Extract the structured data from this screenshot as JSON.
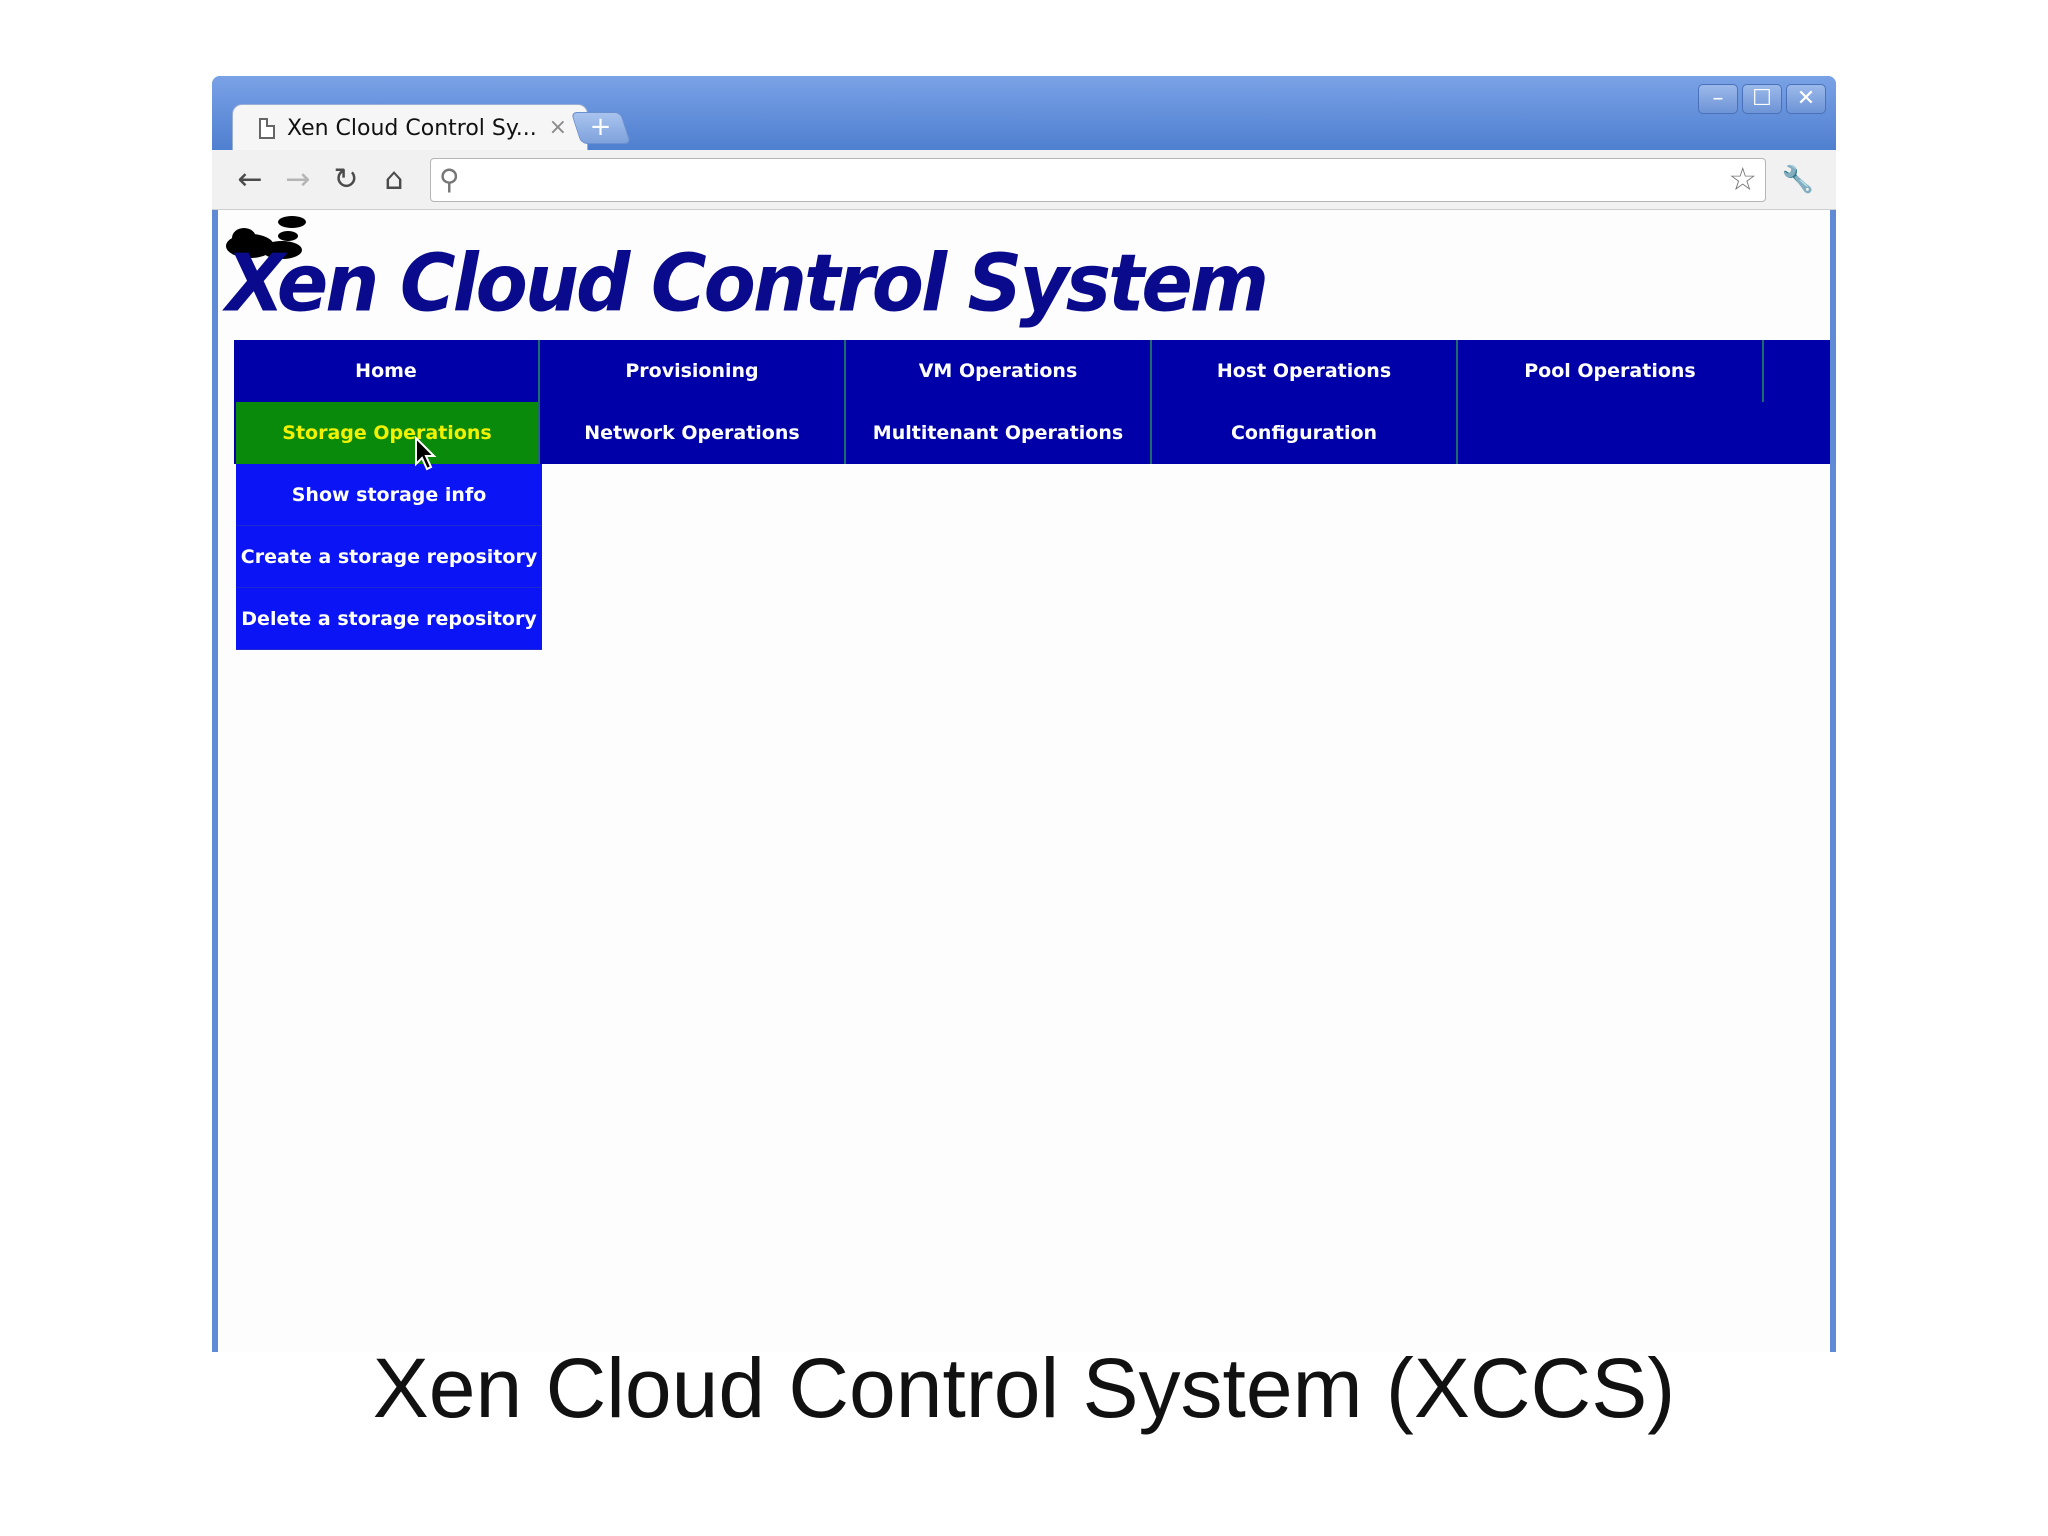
{
  "browser": {
    "tab_title": "Xen Cloud Control Sy...",
    "tab_close": "×",
    "new_tab": "+",
    "window_buttons": {
      "minimize": "–",
      "maximize": "☐",
      "close": "✕"
    },
    "toolbar": {
      "back": "←",
      "forward": "→",
      "reload": "↻",
      "home": "⌂",
      "wrench": "🔧"
    },
    "omnibox": {
      "value": "",
      "search_icon": "⚲",
      "star_icon": "☆"
    }
  },
  "app": {
    "logo_text": "Xen Cloud Control System",
    "menu": {
      "row1": [
        "Home",
        "Provisioning",
        "VM Operations",
        "Host Operations",
        "Pool Operations"
      ],
      "row2": [
        "Storage Operations",
        "Network Operations",
        "Multitenant Operations",
        "Configuration"
      ],
      "active": "Storage Operations"
    },
    "submenu": [
      "Show storage info",
      "Create a storage repository",
      "Delete a storage repository"
    ]
  },
  "caption": "Xen Cloud Control System (XCCS)",
  "colors": {
    "menu_bg": "#0000a8",
    "active_bg": "#0a8a0a",
    "active_text": "#f2f200",
    "submenu_bg": "#0a14f4",
    "logo": "#0a0a8c"
  }
}
